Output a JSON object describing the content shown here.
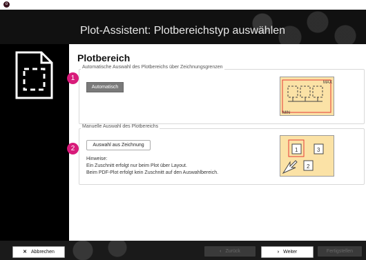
{
  "window": {
    "app_icon_glyph": "o"
  },
  "header": {
    "title": "Plot-Assistent: Plotbereichstyp auswählen"
  },
  "content": {
    "section_title": "Plotbereich",
    "auto": {
      "badge": "1",
      "legend": "Automatische Auswahl des Plotbereichs über Zeichnungsgrenzen",
      "button_label": "Automatisch",
      "illus_max": "MAX",
      "illus_min": "MIN"
    },
    "manual": {
      "badge": "2",
      "legend": "Manuelle Auswahl des Plotbereichs",
      "button_label": "Auswahl aus Zeichnung",
      "hint_title": "Hinweise:",
      "hint_line1": "Ein Zuschnitt erfolgt nur beim Plot über Layout.",
      "hint_line2": "Beim PDF-Plot erfolgt kein Zuschnitt auf den Auswahlbereich.",
      "illus_labels": [
        "1",
        "2",
        "3"
      ]
    }
  },
  "footer": {
    "cancel_label": "Abbrechen",
    "back_label": "Zurück",
    "next_label": "Weiter",
    "finish_label": "Fertigstellen"
  },
  "colors": {
    "badge": "#d81b7a",
    "illustration_bg": "#fbe2a6",
    "accent_red": "#e53935"
  },
  "icons": {
    "document": "document-dashed-icon",
    "cancel": "close-icon",
    "back": "chevron-left-icon",
    "next": "chevron-right-icon"
  }
}
